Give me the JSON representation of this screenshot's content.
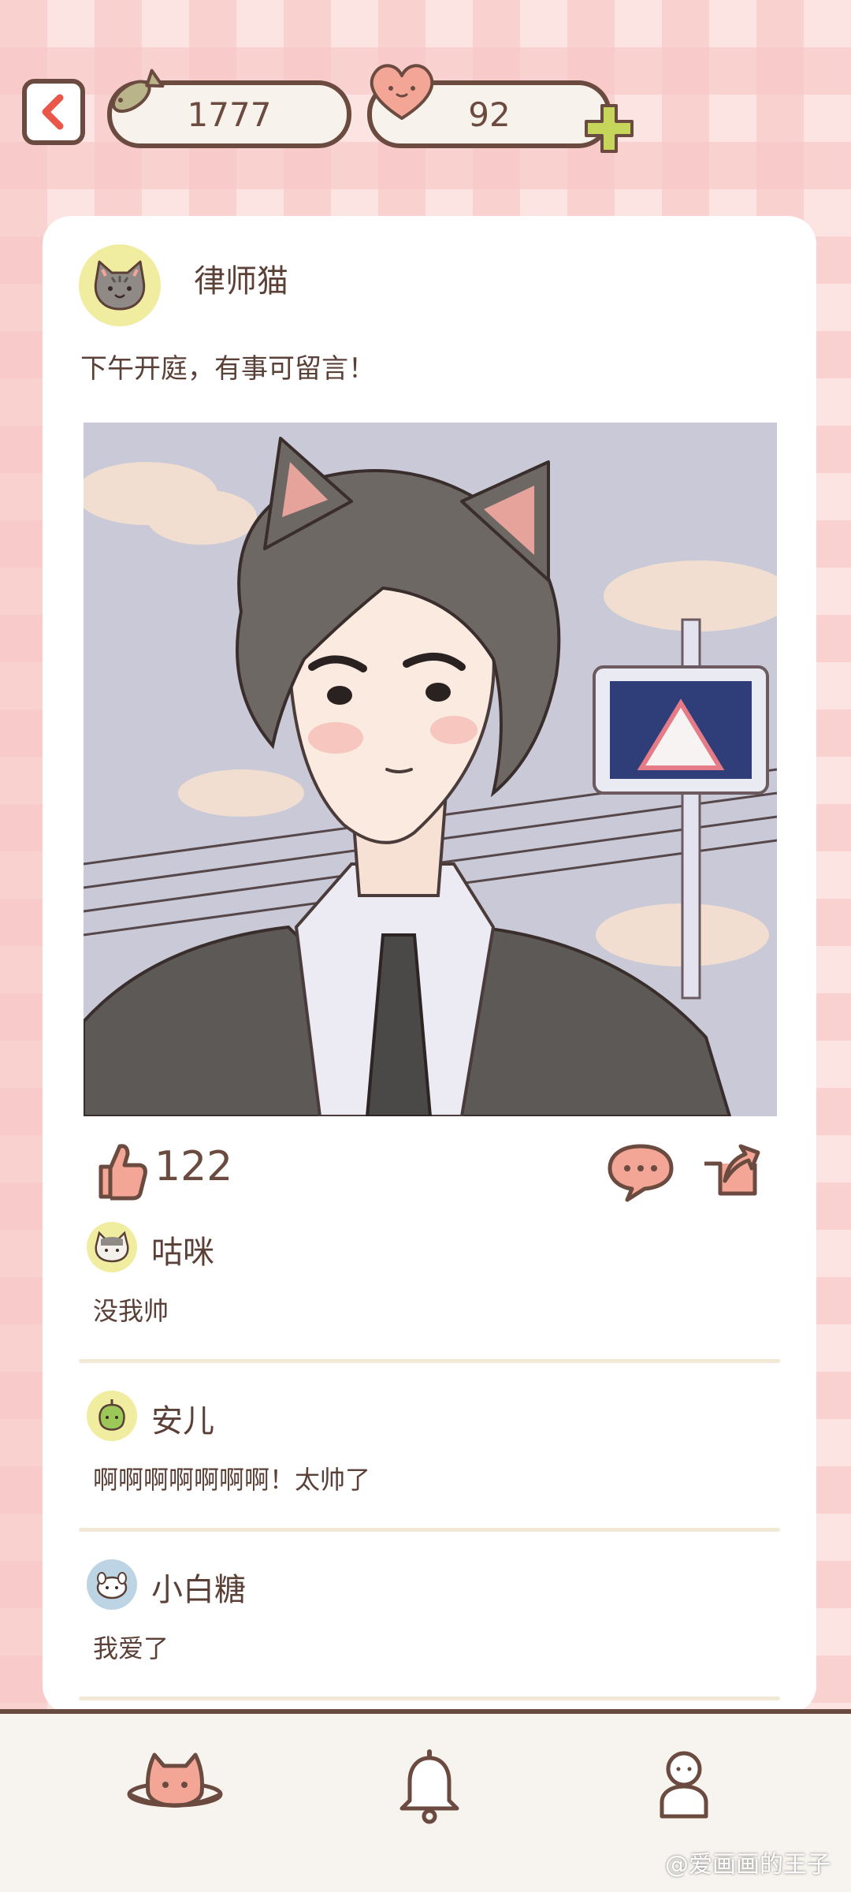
{
  "header": {
    "fish_count": "1777",
    "heart_count": "92"
  },
  "post": {
    "author": "律师猫",
    "text": "下午开庭，有事可留言！",
    "likes": "122"
  },
  "comments": [
    {
      "name": "咕咪",
      "text": "没我帅",
      "avatar_color": "#f0eca0"
    },
    {
      "name": "安儿",
      "text": "啊啊啊啊啊啊啊！太帅了",
      "avatar_color": "#f0eca0"
    },
    {
      "name": "小白糖",
      "text": "我爱了",
      "avatar_color": "#bcd4e4"
    }
  ],
  "watermark": "@爱画画的王子",
  "colors": {
    "outline": "#6b4a3f",
    "accent_pink": "#f4a696",
    "plus_green": "#c6d65a",
    "card_bg": "#ffffff"
  },
  "icons": [
    "back-arrow-icon",
    "fish-icon",
    "heart-icon",
    "plus-icon",
    "like-icon",
    "comment-icon",
    "share-icon",
    "planet-cat-icon",
    "bell-icon",
    "profile-icon"
  ]
}
